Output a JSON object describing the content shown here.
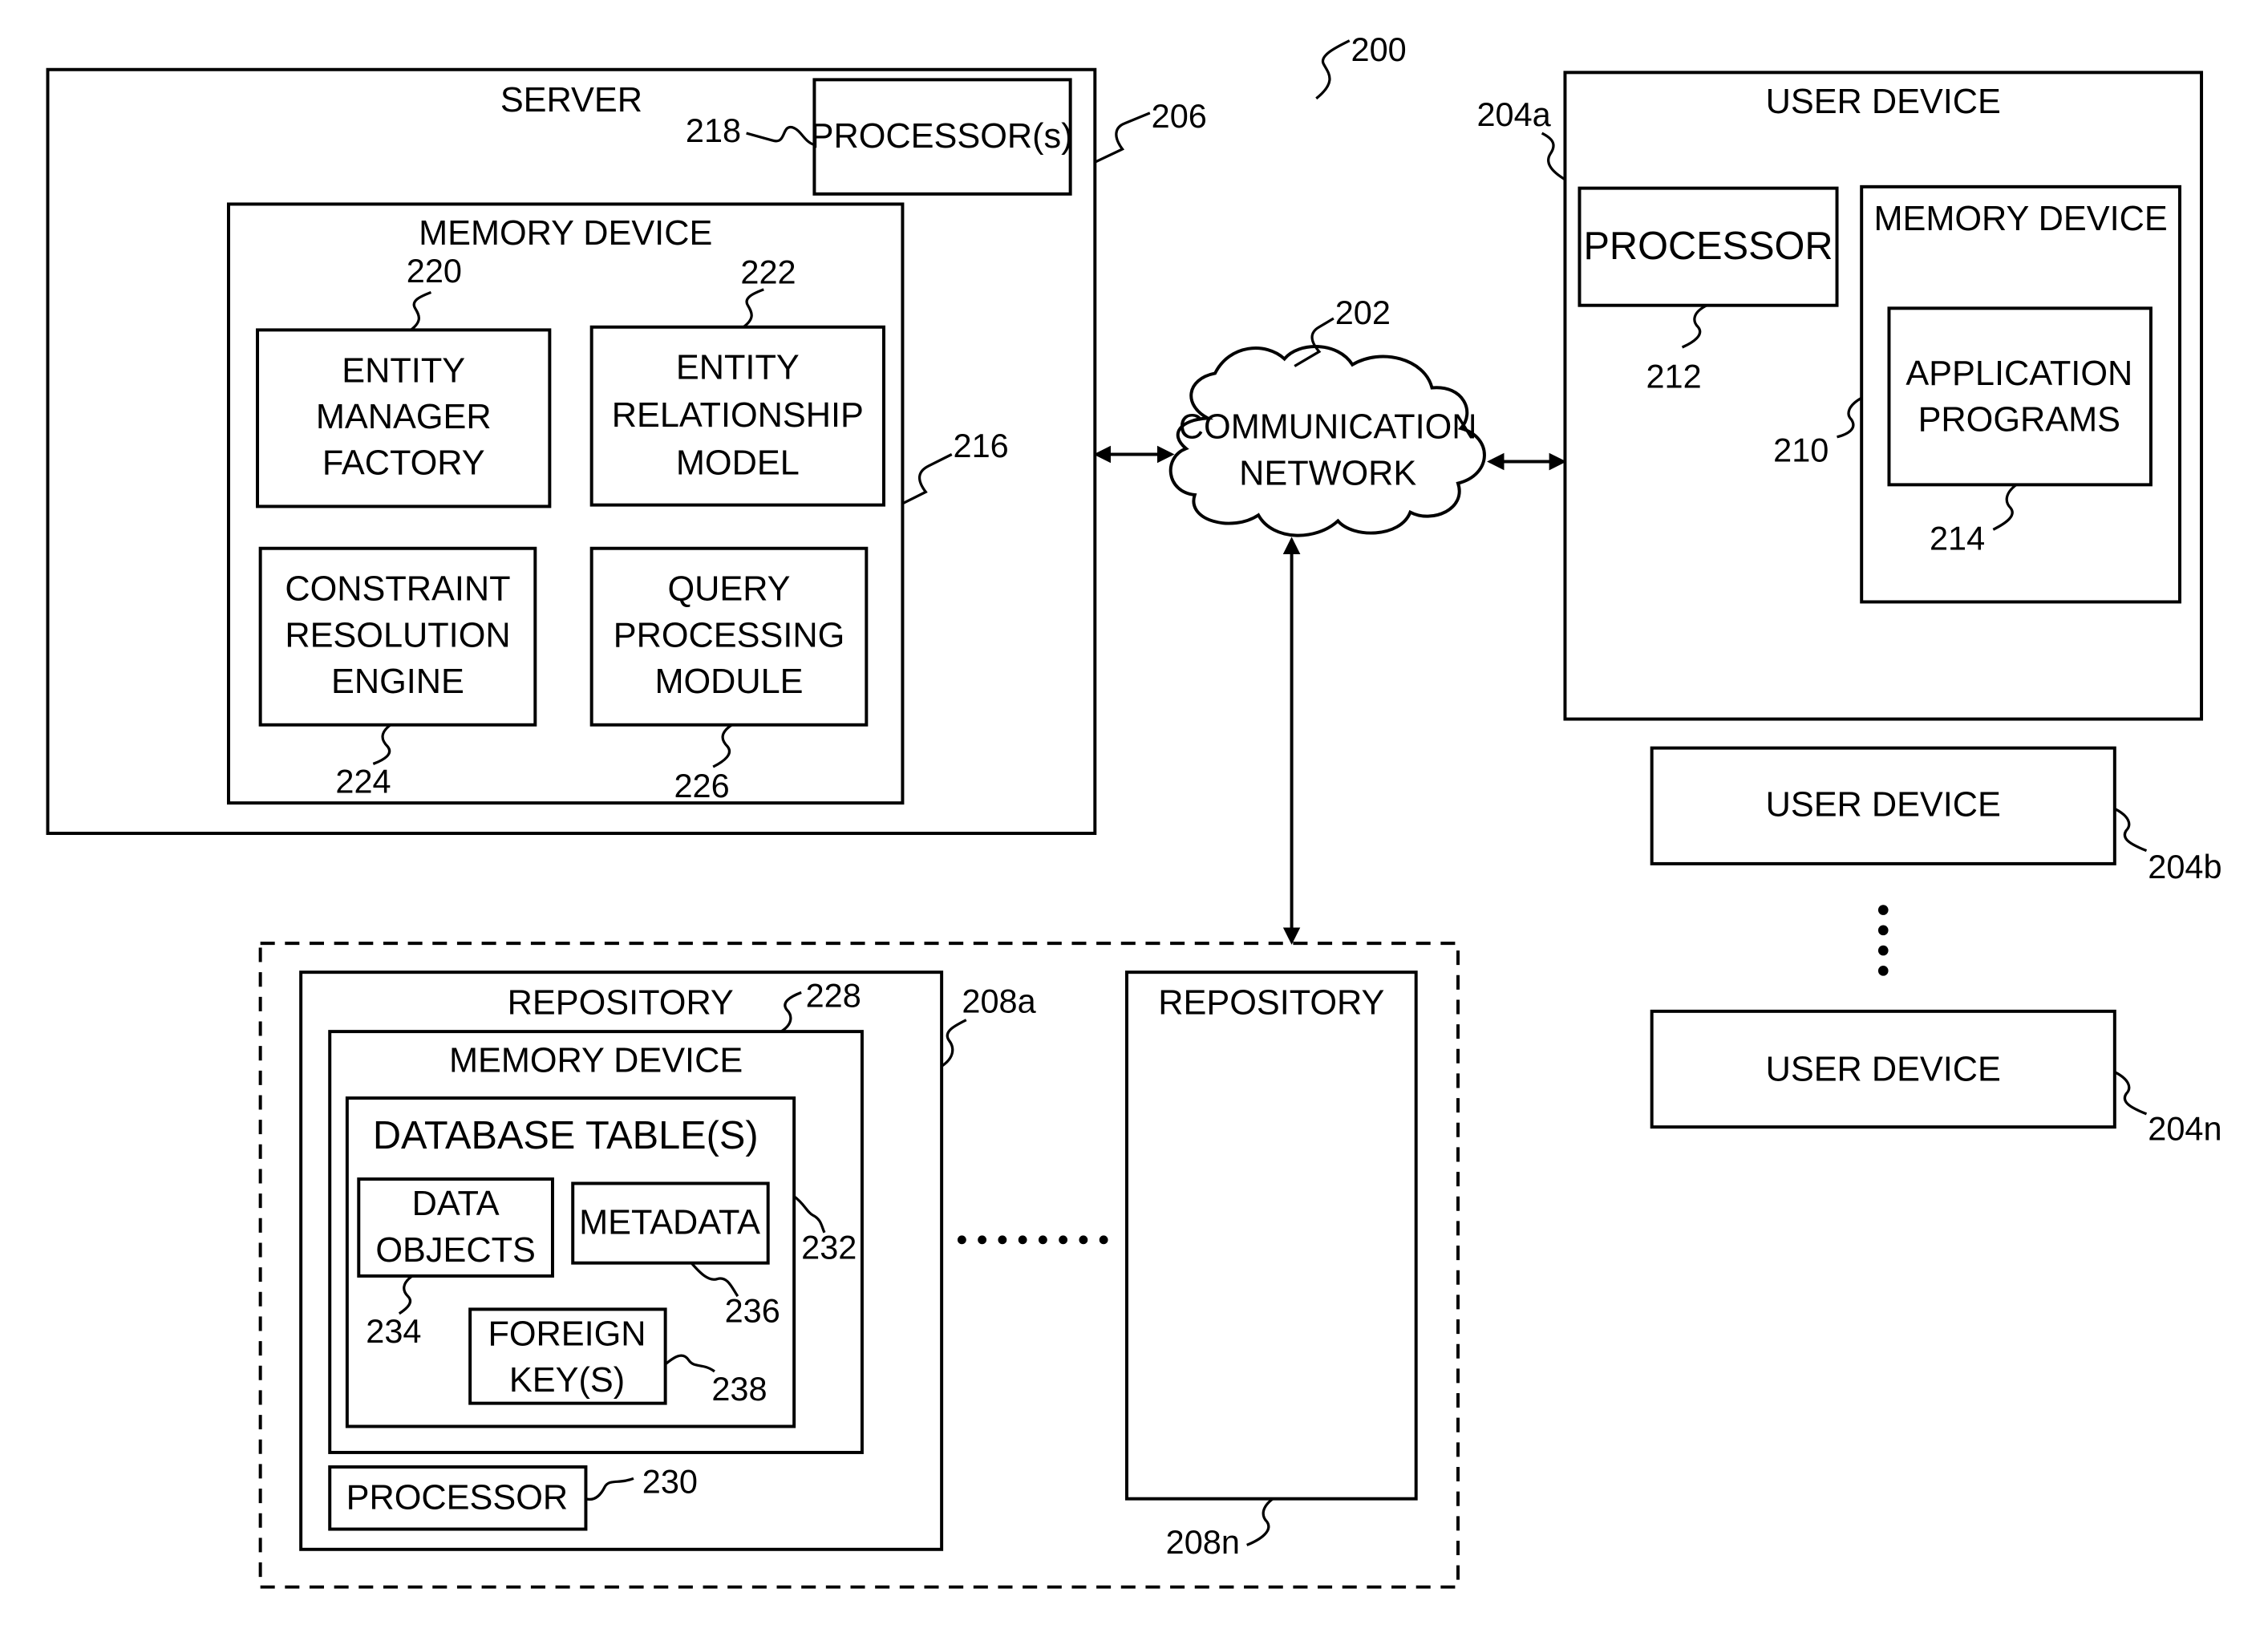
{
  "figure_ref": "200",
  "server": {
    "title": "SERVER",
    "ref": "206",
    "processor": {
      "label": "PROCESSOR(s)",
      "ref": "218"
    },
    "memory": {
      "title": "MEMORY DEVICE",
      "ref": "216",
      "modules": [
        {
          "lines": [
            "ENTITY",
            "MANAGER",
            "FACTORY"
          ],
          "ref": "220"
        },
        {
          "lines": [
            "ENTITY",
            "RELATIONSHIP",
            "MODEL"
          ],
          "ref": "222"
        },
        {
          "lines": [
            "CONSTRAINT",
            "RESOLUTION",
            "ENGINE"
          ],
          "ref": "224"
        },
        {
          "lines": [
            "QUERY",
            "PROCESSING",
            "MODULE"
          ],
          "ref": "226"
        }
      ]
    }
  },
  "network": {
    "lines": [
      "COMMUNICATION",
      "NETWORK"
    ],
    "ref": "202"
  },
  "user_devices": {
    "primary": {
      "title": "USER DEVICE",
      "ref": "204a",
      "processor": {
        "label": "PROCESSOR",
        "ref": "212"
      },
      "memory": {
        "title": "MEMORY DEVICE",
        "ref": "210",
        "app": {
          "lines": [
            "APPLICATION",
            "PROGRAMS"
          ],
          "ref": "214"
        }
      }
    },
    "others": [
      {
        "label": "USER DEVICE",
        "ref": "204b"
      },
      {
        "label": "USER DEVICE",
        "ref": "204n"
      }
    ]
  },
  "repositories": {
    "first": {
      "title": "REPOSITORY",
      "ref": "208a",
      "memory": {
        "title": "MEMORY DEVICE",
        "ref": "228",
        "db": {
          "title": "DATABASE TABLE(S)",
          "ref": "232",
          "data_objects": {
            "lines": [
              "DATA",
              "OBJECTS"
            ],
            "ref": "234"
          },
          "metadata": {
            "label": "METADATA",
            "ref": "236"
          },
          "foreign_keys": {
            "lines": [
              "FOREIGN",
              "KEY(S)"
            ],
            "ref": "238"
          }
        }
      },
      "processor": {
        "label": "PROCESSOR",
        "ref": "230"
      }
    },
    "last": {
      "title": "REPOSITORY",
      "ref": "208n"
    }
  }
}
